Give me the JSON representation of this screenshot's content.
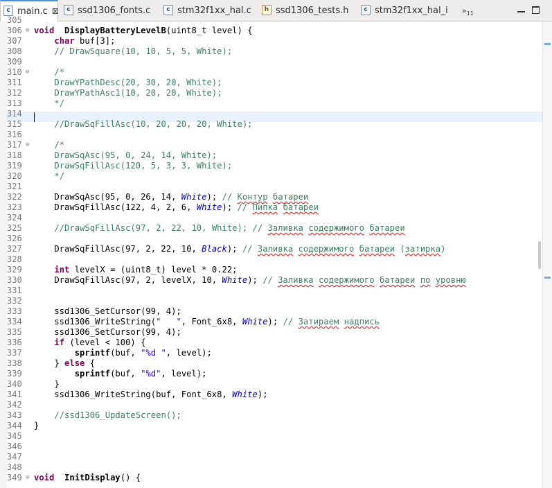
{
  "tabs": [
    {
      "label": "main.c",
      "type": "c",
      "active": true,
      "close": "⊠"
    },
    {
      "label": "ssd1306_fonts.c",
      "type": "c"
    },
    {
      "label": "stm32f1xx_hal.c",
      "type": "c"
    },
    {
      "label": "ssd1306_tests.h",
      "type": "h"
    },
    {
      "label": "stm32f1xx_hal_i",
      "type": "c"
    }
  ],
  "overflow": {
    "symbol": "»",
    "count": "11"
  },
  "file_icon_letters": {
    "c": "c",
    "h": "h"
  },
  "lines": [
    {
      "n": "305",
      "segs": []
    },
    {
      "n": "306",
      "fold": "⊖",
      "segs": [
        [
          "kw",
          "void"
        ],
        [
          "",
          "  "
        ],
        [
          "fn",
          "DisplayBatteryLevelB"
        ],
        [
          "",
          "(uint8_t level) {"
        ]
      ]
    },
    {
      "n": "307",
      "segs": [
        [
          "",
          "    "
        ],
        [
          "kw",
          "char"
        ],
        [
          "",
          " buf[3];"
        ]
      ]
    },
    {
      "n": "308",
      "segs": [
        [
          "",
          "    "
        ],
        [
          "cm",
          "// DrawSquare(10, 10, 5, 5, White);"
        ]
      ]
    },
    {
      "n": "309",
      "segs": []
    },
    {
      "n": "310",
      "fold": "⊖",
      "segs": [
        [
          "",
          "    "
        ],
        [
          "cm",
          "/*"
        ]
      ]
    },
    {
      "n": "311",
      "segs": [
        [
          "",
          "    "
        ],
        [
          "cm",
          "DrawYPathDesc(20, 30, 20, White);"
        ]
      ]
    },
    {
      "n": "312",
      "segs": [
        [
          "",
          "    "
        ],
        [
          "cm",
          "DrawYPathAsc1(10, 20, 20, White);"
        ]
      ]
    },
    {
      "n": "313",
      "segs": [
        [
          "",
          "    "
        ],
        [
          "cm",
          "*/"
        ]
      ]
    },
    {
      "n": "314",
      "segs": []
    },
    {
      "n": "315",
      "segs": [
        [
          "",
          "    "
        ],
        [
          "cm",
          "//DrawSqFillAsc(10, 20, 20, 20, White);"
        ]
      ]
    },
    {
      "n": "316",
      "segs": []
    },
    {
      "n": "317",
      "fold": "⊖",
      "segs": [
        [
          "",
          "    "
        ],
        [
          "cm",
          "/*"
        ]
      ]
    },
    {
      "n": "318",
      "segs": [
        [
          "",
          "    "
        ],
        [
          "cm",
          "DrawSqAsc(95, 0, 24, 14, White);"
        ]
      ]
    },
    {
      "n": "319",
      "segs": [
        [
          "",
          "    "
        ],
        [
          "cm",
          "DrawSqFillAsc(120, 5, 3, 3, White);"
        ]
      ]
    },
    {
      "n": "320",
      "segs": [
        [
          "",
          "    "
        ],
        [
          "cm",
          "*/"
        ]
      ]
    },
    {
      "n": "321",
      "segs": []
    },
    {
      "n": "322",
      "segs": [
        [
          "",
          "    DrawSqAsc(95, 0, 26, 14, "
        ],
        [
          "enm",
          "White"
        ],
        [
          "",
          "); "
        ],
        [
          "cm",
          "// "
        ],
        [
          "cm-ru",
          "Контур"
        ],
        [
          "cm",
          " "
        ],
        [
          "cm-ru",
          "батареи"
        ]
      ]
    },
    {
      "n": "323",
      "segs": [
        [
          "",
          "    DrawSqFillAsc(122, 4, 2, 6, "
        ],
        [
          "enm",
          "White"
        ],
        [
          "",
          "); "
        ],
        [
          "cm",
          "// "
        ],
        [
          "cm-ru",
          "Пипка"
        ],
        [
          "cm",
          " "
        ],
        [
          "cm-ru",
          "батареи"
        ]
      ]
    },
    {
      "n": "324",
      "segs": []
    },
    {
      "n": "325",
      "segs": [
        [
          "",
          "    "
        ],
        [
          "cm",
          "//DrawSqFillAsc(97, 2, 22, 10, White); // "
        ],
        [
          "cm-ru",
          "Заливка"
        ],
        [
          "cm",
          " "
        ],
        [
          "cm-ru",
          "содержимого"
        ],
        [
          "cm",
          " "
        ],
        [
          "cm-ru",
          "батареи"
        ]
      ]
    },
    {
      "n": "326",
      "segs": []
    },
    {
      "n": "327",
      "segs": [
        [
          "",
          "    DrawSqFillAsc(97, 2, 22, 10, "
        ],
        [
          "enm",
          "Black"
        ],
        [
          "",
          "); "
        ],
        [
          "cm",
          "// "
        ],
        [
          "cm-ru",
          "Заливка"
        ],
        [
          "cm",
          " "
        ],
        [
          "cm-ru",
          "содержимого"
        ],
        [
          "cm",
          " "
        ],
        [
          "cm-ru",
          "батареи"
        ],
        [
          "cm",
          " ("
        ],
        [
          "cm-ru",
          "затирка"
        ],
        [
          "cm",
          ")"
        ]
      ]
    },
    {
      "n": "328",
      "segs": []
    },
    {
      "n": "329",
      "segs": [
        [
          "",
          "    "
        ],
        [
          "kw",
          "int"
        ],
        [
          "",
          " levelX = (uint8_t) level * 0.22;"
        ]
      ]
    },
    {
      "n": "330",
      "segs": [
        [
          "",
          "    DrawSqFillAsc(97, 2, levelX, 10, "
        ],
        [
          "enm",
          "White"
        ],
        [
          "",
          "); "
        ],
        [
          "cm",
          "// "
        ],
        [
          "cm-ru",
          "Заливка"
        ],
        [
          "cm",
          " "
        ],
        [
          "cm-ru",
          "содержимого"
        ],
        [
          "cm",
          " "
        ],
        [
          "cm-ru",
          "батареи"
        ],
        [
          "cm",
          " "
        ],
        [
          "cm-ru",
          "по"
        ],
        [
          "cm",
          " "
        ],
        [
          "cm-ru",
          "уровню"
        ]
      ]
    },
    {
      "n": "331",
      "segs": []
    },
    {
      "n": "332",
      "segs": []
    },
    {
      "n": "333",
      "segs": [
        [
          "",
          "    ssd1306_SetCursor(99, 4);"
        ]
      ]
    },
    {
      "n": "334",
      "segs": [
        [
          "",
          "    ssd1306_WriteString("
        ],
        [
          "str",
          "\"   \""
        ],
        [
          "",
          ", Font_6x8, "
        ],
        [
          "enm",
          "White"
        ],
        [
          "",
          "); "
        ],
        [
          "cm",
          "// "
        ],
        [
          "cm-ru",
          "Затираем"
        ],
        [
          "cm",
          " "
        ],
        [
          "cm-ru",
          "надпись"
        ]
      ]
    },
    {
      "n": "335",
      "segs": [
        [
          "",
          "    ssd1306_SetCursor(99, 4);"
        ]
      ]
    },
    {
      "n": "336",
      "segs": [
        [
          "",
          "    "
        ],
        [
          "kw",
          "if"
        ],
        [
          "",
          " (level < 100) {"
        ]
      ]
    },
    {
      "n": "337",
      "segs": [
        [
          "",
          "        "
        ],
        [
          "fn2",
          "sprintf"
        ],
        [
          "",
          "(buf, "
        ],
        [
          "str",
          "\"%d \""
        ],
        [
          "",
          ", level);"
        ]
      ]
    },
    {
      "n": "338",
      "segs": [
        [
          "",
          "    } "
        ],
        [
          "kw",
          "else"
        ],
        [
          "",
          " {"
        ]
      ]
    },
    {
      "n": "339",
      "segs": [
        [
          "",
          "        "
        ],
        [
          "fn2",
          "sprintf"
        ],
        [
          "",
          "(buf, "
        ],
        [
          "str",
          "\"%d\""
        ],
        [
          "",
          ", level);"
        ]
      ]
    },
    {
      "n": "340",
      "segs": [
        [
          "",
          "    }"
        ]
      ]
    },
    {
      "n": "341",
      "segs": [
        [
          "",
          "    ssd1306_WriteString(buf, Font_6x8, "
        ],
        [
          "enm",
          "White"
        ],
        [
          "",
          ");"
        ]
      ]
    },
    {
      "n": "342",
      "segs": []
    },
    {
      "n": "343",
      "segs": [
        [
          "",
          "    "
        ],
        [
          "cm",
          "//ssd1306_UpdateScreen();"
        ]
      ]
    },
    {
      "n": "344",
      "segs": [
        [
          "",
          "}"
        ]
      ]
    },
    {
      "n": "345",
      "segs": []
    },
    {
      "n": "346",
      "segs": []
    },
    {
      "n": "347",
      "segs": []
    },
    {
      "n": "348",
      "segs": []
    },
    {
      "n": "349",
      "fold": "⊖",
      "segs": [
        [
          "kw",
          "void"
        ],
        [
          "",
          "  "
        ],
        [
          "fn",
          "InitDisplay"
        ],
        [
          "",
          "() {"
        ]
      ]
    }
  ]
}
